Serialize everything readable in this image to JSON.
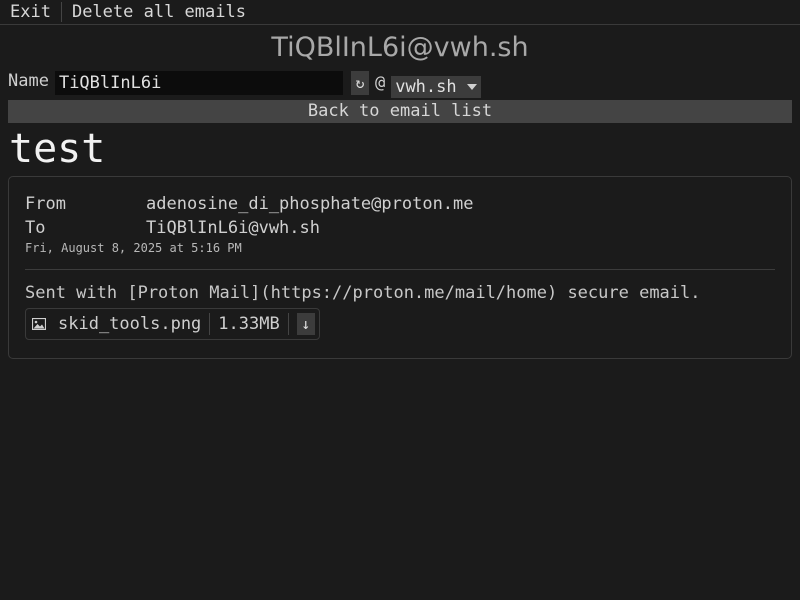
{
  "menu": {
    "exit_label": "Exit",
    "delete_all_label": "Delete all emails"
  },
  "address": {
    "full": "TiQBlInL6i@vwh.sh",
    "name_label": "Name",
    "name_value": "TiQBlInL6i",
    "refresh_icon": "refresh-icon",
    "at": "@",
    "domain": "vwh.sh"
  },
  "back_label": "Back to email list",
  "email": {
    "subject": "test",
    "from_label": "From",
    "from": "adenosine_di_phosphate@proton.me",
    "to_label": "To",
    "to": "TiQBlInL6i@vwh.sh",
    "date": "Fri, August 8, 2025 at 5:16 PM",
    "body": "Sent with [Proton Mail](https://proton.me/mail/home) secure email.",
    "attachment": {
      "filename": "skid_tools.png",
      "size": "1.33MB"
    }
  },
  "colors": {
    "background": "#1b1b1b",
    "button_bg": "#444444"
  }
}
